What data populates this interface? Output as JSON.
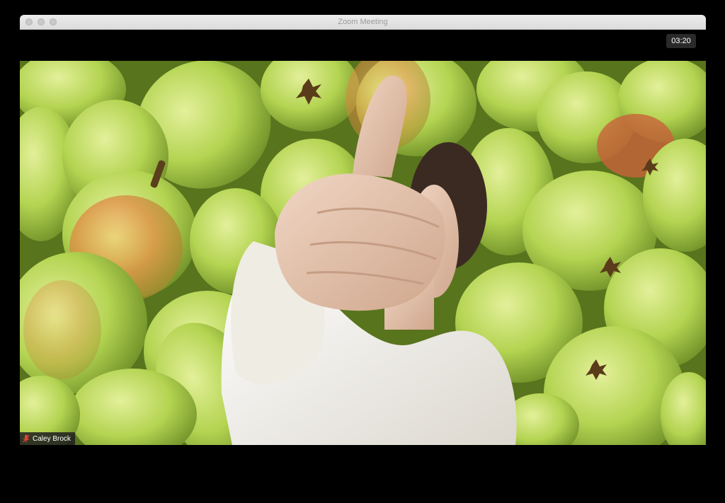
{
  "window": {
    "title": "Zoom Meeting"
  },
  "meeting": {
    "timer": "03:20",
    "participant_name": "Caley Brock",
    "mic_status": "muted"
  },
  "colors": {
    "pear_green": "#b7d65a",
    "pear_light": "#d6e98a",
    "pear_shadow": "#6f8f2a",
    "blush": "#e07a3a",
    "shirt": "#f2efe8",
    "skin": "#e8c9b4",
    "hair": "#3b2a22",
    "mic_muted": "#e0463c"
  },
  "icons": {
    "mic": "microphone-muted-icon"
  }
}
